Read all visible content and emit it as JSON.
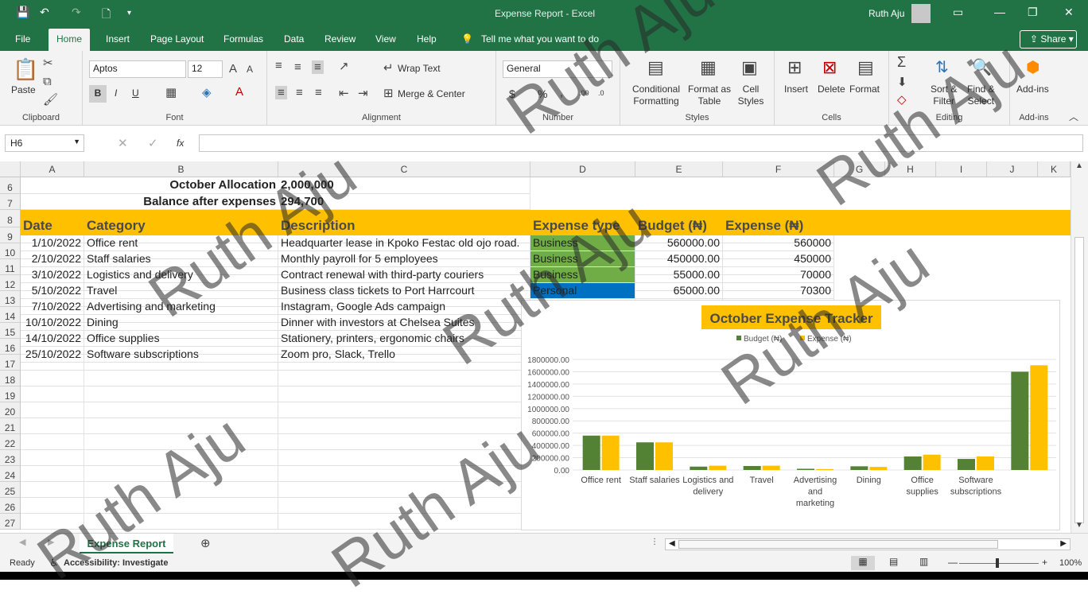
{
  "window": {
    "title": "Expense Report  -  Excel",
    "user": "Ruth Aju"
  },
  "quick_access": {
    "autosave_icon": "save-icon",
    "undo_icon": "undo-icon",
    "redo_icon": "redo-icon",
    "new_icon": "new-document-icon",
    "customize_icon": "customize-icon"
  },
  "menu": {
    "tabs": [
      "File",
      "Home",
      "Insert",
      "Page Layout",
      "Formulas",
      "Data",
      "Review",
      "View",
      "Help"
    ],
    "active": "Home",
    "tell_me": "Tell me what you want to do",
    "share": "Share"
  },
  "ribbon": {
    "clipboard": {
      "paste": "Paste",
      "label": "Clipboard"
    },
    "font": {
      "name": "Aptos",
      "size": "12",
      "label": "Font",
      "bold": "B",
      "italic": "I",
      "underline": "U"
    },
    "alignment": {
      "wrap": "Wrap Text",
      "merge": "Merge & Center",
      "label": "Alignment"
    },
    "number": {
      "format": "General",
      "currency": "$",
      "percent": "%",
      "comma": ",",
      "inc_dec": ".00",
      "dec_dec": ".0",
      "label": "Number"
    },
    "styles": {
      "conditional": [
        "Conditional",
        "Formatting"
      ],
      "format_table": [
        "Format as",
        "Table"
      ],
      "cell_styles": [
        "Cell",
        "Styles"
      ],
      "label": "Styles"
    },
    "cells": {
      "insert": "Insert",
      "delete": "Delete",
      "format": "Format",
      "label": "Cells"
    },
    "editing": {
      "sort": [
        "Sort &",
        "Filter"
      ],
      "find": [
        "Find &",
        "Select"
      ],
      "label": "Editing"
    },
    "addins": {
      "name": "Add-ins",
      "label": "Add-ins"
    }
  },
  "formula_bar": {
    "name_box": "H6",
    "fx": "fx",
    "value": ""
  },
  "columns": [
    "A",
    "B",
    "C",
    "D",
    "E",
    "F",
    "G",
    "H",
    "I",
    "J",
    "K"
  ],
  "rows": [
    "6",
    "7",
    "8",
    "9",
    "10",
    "11",
    "12",
    "13",
    "14",
    "15",
    "16",
    "17",
    "18",
    "19",
    "20",
    "21",
    "22",
    "23",
    "24",
    "25",
    "26",
    "27"
  ],
  "summary": {
    "alloc_label": "October Allocation",
    "alloc_value": "2,000,000",
    "balance_label": "Balance after expenses",
    "balance_value": "294,700"
  },
  "table": {
    "headers": [
      "Date",
      "Category",
      "Description",
      "Expense type",
      "Budget (₦)",
      "Expense (₦)"
    ],
    "rows": [
      [
        "1/10/2022",
        "Office rent",
        "Headquarter lease in Kpoko Festac old ojo road.",
        "Business",
        "560000.00",
        "560000"
      ],
      [
        "2/10/2022",
        "Staff salaries",
        "Monthly payroll for 5 employees",
        "Business",
        "450000.00",
        "450000"
      ],
      [
        "3/10/2022",
        "Logistics and delivery",
        "Contract renewal with third-party couriers",
        "Business",
        "55000.00",
        "70000"
      ],
      [
        "5/10/2022",
        "Travel",
        "Business class tickets to Port Harrcourt",
        "Personal",
        "65000.00",
        "70300"
      ],
      [
        "7/10/2022",
        "Advertising and marketing",
        "Instagram, Google Ads campaign",
        "",
        "",
        ""
      ],
      [
        "10/10/2022",
        "Dining",
        "Dinner with investors at Chelsea Suites",
        "",
        "",
        ""
      ],
      [
        "14/10/2022",
        "Office supplies",
        "Stationery, printers, ergonomic chairs",
        "",
        "",
        ""
      ],
      [
        "25/10/2022",
        "Software subscriptions",
        "Zoom pro, Slack, Trello",
        "",
        "",
        ""
      ]
    ]
  },
  "colors": {
    "excel_green": "#217346",
    "header_fill": "#ffc000",
    "business_fill": "#70ad47",
    "personal_fill": "#0070c0",
    "budget_series": "#548235",
    "expense_series": "#ffc000"
  },
  "chart_data": {
    "type": "bar",
    "title": "October Expense Tracker",
    "categories": [
      "Office rent",
      "Staff salaries",
      "Logistics and delivery",
      "Travel",
      "Advertising and marketing",
      "Dining",
      "Office supplies",
      "Software subscriptions",
      ""
    ],
    "category_lines": [
      [
        "Office rent"
      ],
      [
        "Staff salaries"
      ],
      [
        "Logistics and",
        "delivery"
      ],
      [
        "Travel"
      ],
      [
        "Advertising",
        "and",
        "marketing"
      ],
      [
        "Dining"
      ],
      [
        "Office",
        "supplies"
      ],
      [
        "Software",
        "subscriptions"
      ],
      []
    ],
    "series": [
      {
        "name": "Budget (₦)",
        "values": [
          560000,
          450000,
          55000,
          65000,
          20000,
          60000,
          220000,
          180000,
          1600000
        ]
      },
      {
        "name": "Expense (₦)",
        "values": [
          560000,
          450000,
          70000,
          70300,
          15000,
          50000,
          250000,
          220000,
          1705300
        ]
      }
    ],
    "yticks": [
      "1800000.00",
      "1600000.00",
      "1400000.00",
      "1200000.00",
      "1000000.00",
      "800000.00",
      "600000.00",
      "400000.00",
      "200000.00",
      "0.00"
    ],
    "ylim": [
      0,
      1800000
    ],
    "grid": true,
    "legend": "top"
  },
  "sheet_tab": "Expense Report",
  "status": {
    "ready": "Ready",
    "accessibility": "Accessibility: Investigate",
    "zoom": "100%"
  },
  "watermark": "Ruth Aju"
}
